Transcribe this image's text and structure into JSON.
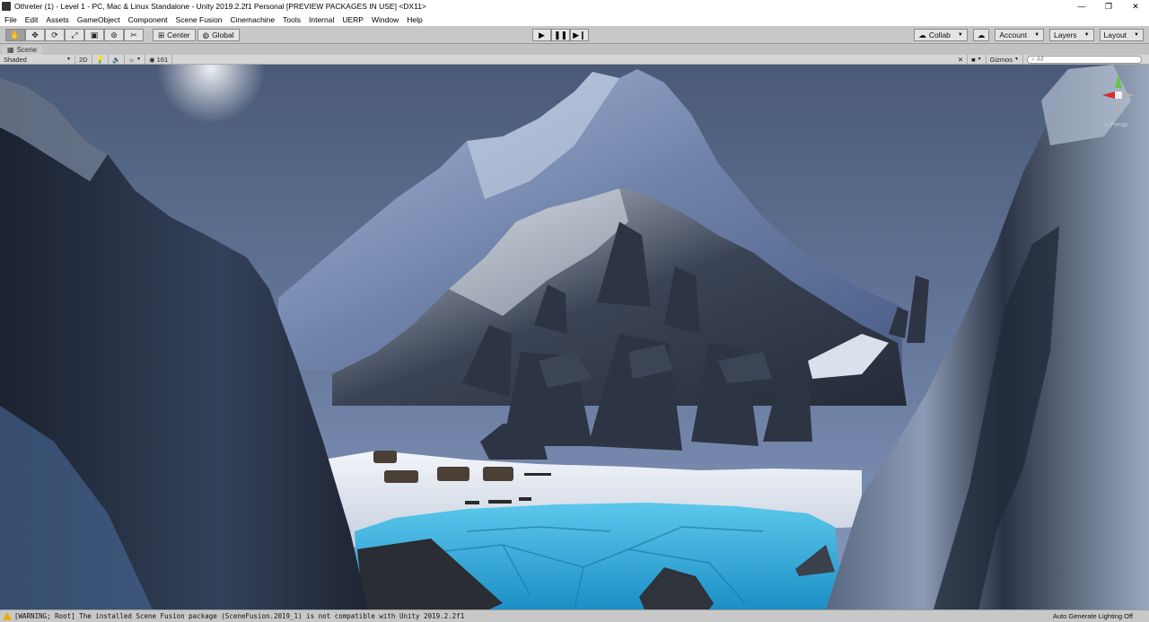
{
  "window": {
    "title": "Othreter (1) - Level 1 - PC, Mac & Linux Standalone - Unity 2019.2.2f1 Personal [PREVIEW PACKAGES IN USE] <DX11>",
    "controls": {
      "minimize": "—",
      "maximize": "❐",
      "close": "✕"
    }
  },
  "menu": [
    "File",
    "Edit",
    "Assets",
    "GameObject",
    "Component",
    "Scene Fusion",
    "Cinemachine",
    "Tools",
    "Internal",
    "UERP",
    "Window",
    "Help"
  ],
  "toolbar": {
    "tools": [
      "hand-icon",
      "move-icon",
      "rotate-icon",
      "scale-icon",
      "rect-icon",
      "transform-icon",
      "custom-tool-icon"
    ],
    "pivot": "Center",
    "space": "Global",
    "collab": "Collab",
    "account": "Account",
    "layers": "Layers",
    "layout": "Layout"
  },
  "scene": {
    "tab": "Scene",
    "shading": "Shaded",
    "mode2d": "2D",
    "hidden_count": "161",
    "gizmos": "Gizmos",
    "search_placeholder": "All",
    "persp": "< Persp"
  },
  "status": {
    "warning": "[WARNING; Root] The installed Scene Fusion package (SceneFusion.2019_1) is not compatible with Unity 2019.2.2f1",
    "right": "Auto Generate Lighting Off"
  },
  "colors": {
    "sky_top": "#4a5a78",
    "sky_bottom": "#7d8fb2",
    "snow": "#dfe6ef",
    "water": "#2fa6d6",
    "rock": "#2e3646"
  }
}
